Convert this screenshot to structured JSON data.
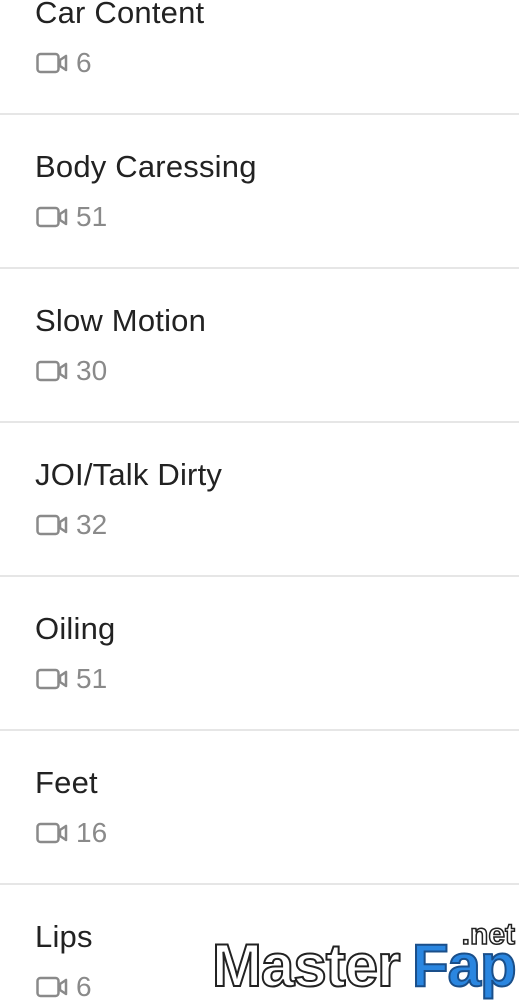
{
  "categories": [
    {
      "title": "Car Content",
      "count": "6"
    },
    {
      "title": "Body Caressing",
      "count": "51"
    },
    {
      "title": "Slow Motion",
      "count": "30"
    },
    {
      "title": "JOI/Talk Dirty",
      "count": "32"
    },
    {
      "title": "Oiling",
      "count": "51"
    },
    {
      "title": "Feet",
      "count": "16"
    },
    {
      "title": "Lips",
      "count": "6"
    }
  ],
  "icons": {
    "count_icon": "video-camera-icon"
  },
  "watermark": {
    "master": "Master",
    "fap": "Fap",
    "net": ".net"
  },
  "colors": {
    "title": "#222222",
    "count": "#8a8a8a",
    "divider": "#e6e6e6",
    "watermark_accent": "#2a86e0"
  }
}
